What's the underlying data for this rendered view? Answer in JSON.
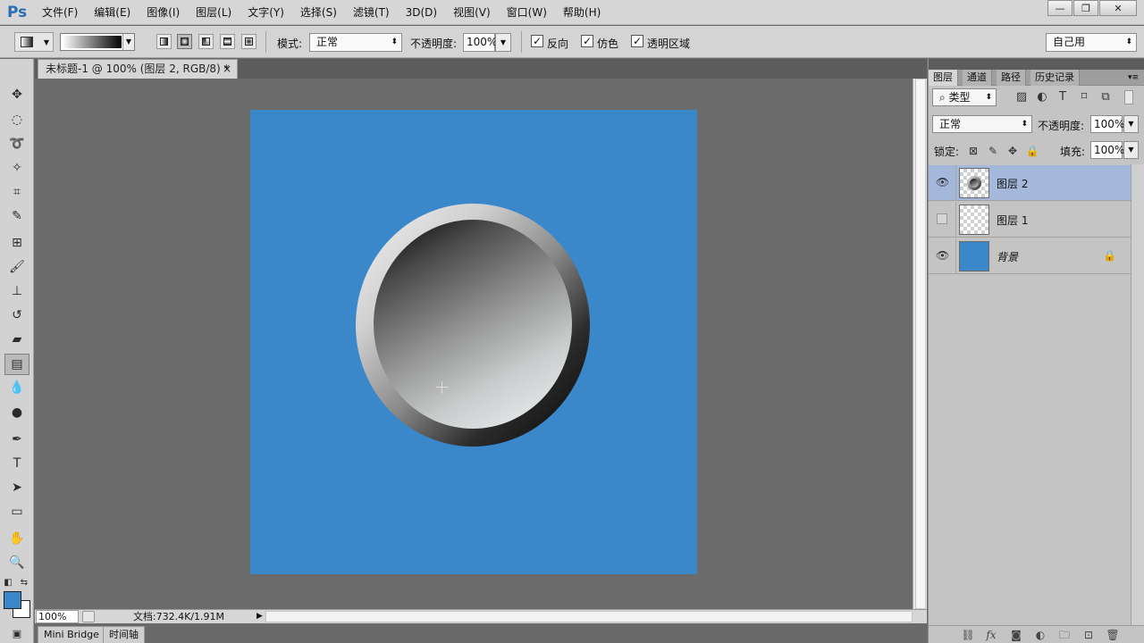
{
  "app": {
    "logo": "Ps"
  },
  "menu": [
    "文件(F)",
    "编辑(E)",
    "图像(I)",
    "图层(L)",
    "文字(Y)",
    "选择(S)",
    "滤镜(T)",
    "3D(D)",
    "视图(V)",
    "窗口(W)",
    "帮助(H)"
  ],
  "window_controls": {
    "minimize": "—",
    "restore": "❐",
    "close": "✕"
  },
  "options": {
    "mode_label": "模式:",
    "mode_value": "正常",
    "opacity_label": "不透明度:",
    "opacity_value": "100%",
    "reverse_label": "反向",
    "dither_label": "仿色",
    "transparency_label": "透明区域",
    "checkmark": "✓",
    "workspace_value": "自己用"
  },
  "document": {
    "tab_title": "未标题-1 @ 100% (图层 2, RGB/8) *",
    "tab_close": "×",
    "canvas_color": "#3a88c9"
  },
  "status": {
    "zoom": "100%",
    "doc_info": "文档:732.4K/1.91M",
    "arrow": "▶"
  },
  "bottom_tabs": {
    "mini_bridge": "Mini Bridge",
    "timeline": "时间轴"
  },
  "panel": {
    "tabs": [
      "图层",
      "通道",
      "路径",
      "历史记录"
    ],
    "filter_value": "类型",
    "blend_value": "正常",
    "opacity_label": "不透明度:",
    "opacity_value": "100%",
    "lock_label": "锁定:",
    "fill_label": "填充:",
    "fill_value": "100%",
    "layers": [
      {
        "name": "图层 2",
        "visible": true,
        "selected": true
      },
      {
        "name": "图层 1",
        "visible": false,
        "selected": false
      },
      {
        "name": "背景",
        "visible": true,
        "selected": false,
        "locked": true
      }
    ]
  },
  "colors": {
    "foreground": "#3a88c9",
    "background": "#ffffff",
    "selection": "#a4b8dc"
  }
}
